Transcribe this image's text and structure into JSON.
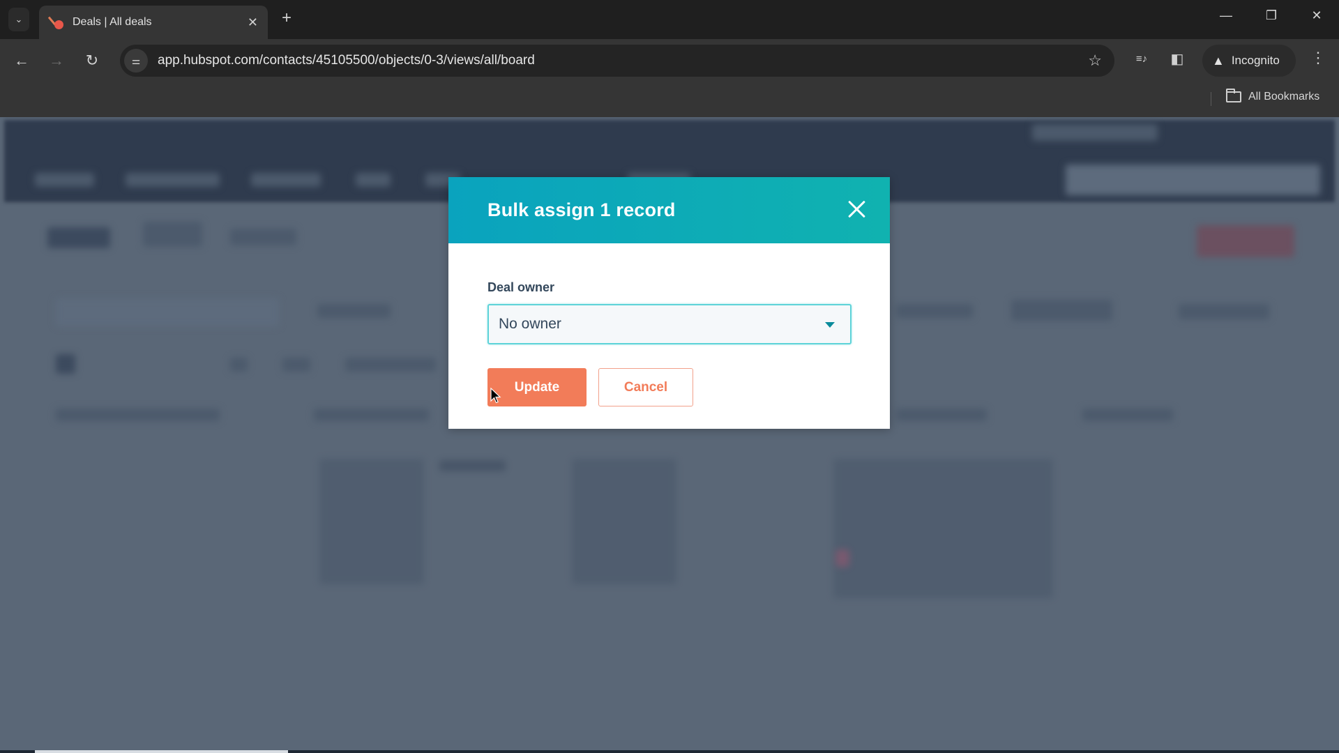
{
  "browser": {
    "tab": {
      "title": "Deals | All deals",
      "favicon": "hubspot-sprocket-icon"
    },
    "url": "app.hubspot.com/contacts/45105500/objects/0-3/views/all/board",
    "incognito_label": "Incognito",
    "bookmarks_label": "All Bookmarks",
    "icons": {
      "tab_list": "chevron-down-icon",
      "new_tab": "plus-icon",
      "back": "arrow-left-icon",
      "forward": "arrow-right-icon",
      "reload": "reload-icon",
      "site_info": "tune-icon",
      "bookmark": "star-icon",
      "media": "media-queue-icon",
      "side_panel": "side-panel-icon",
      "incognito": "incognito-icon",
      "menu": "kebab-menu-icon",
      "minimize": "minimize-icon",
      "restore": "restore-icon",
      "close": "close-icon"
    },
    "glyphs": {
      "tab_list": "⌄",
      "tab_close": "✕",
      "new_tab": "+",
      "back": "←",
      "forward": "→",
      "reload": "↻",
      "site_info": "⚌",
      "star": "☆",
      "media": "≡♪",
      "side_panel": "◧",
      "incognito": "🕵",
      "menu": "⋮",
      "minimize": "—",
      "restore": "❐",
      "close": "✕"
    }
  },
  "modal": {
    "title": "Bulk assign 1 record",
    "field_label": "Deal owner",
    "select_value": "No owner",
    "update_label": "Update",
    "cancel_label": "Cancel",
    "colors": {
      "header_start": "#0aa3be",
      "header_end": "#10b2b0",
      "primary_button": "#f27c59",
      "select_border": "#5ed3d8",
      "label_text": "#33475b"
    }
  }
}
